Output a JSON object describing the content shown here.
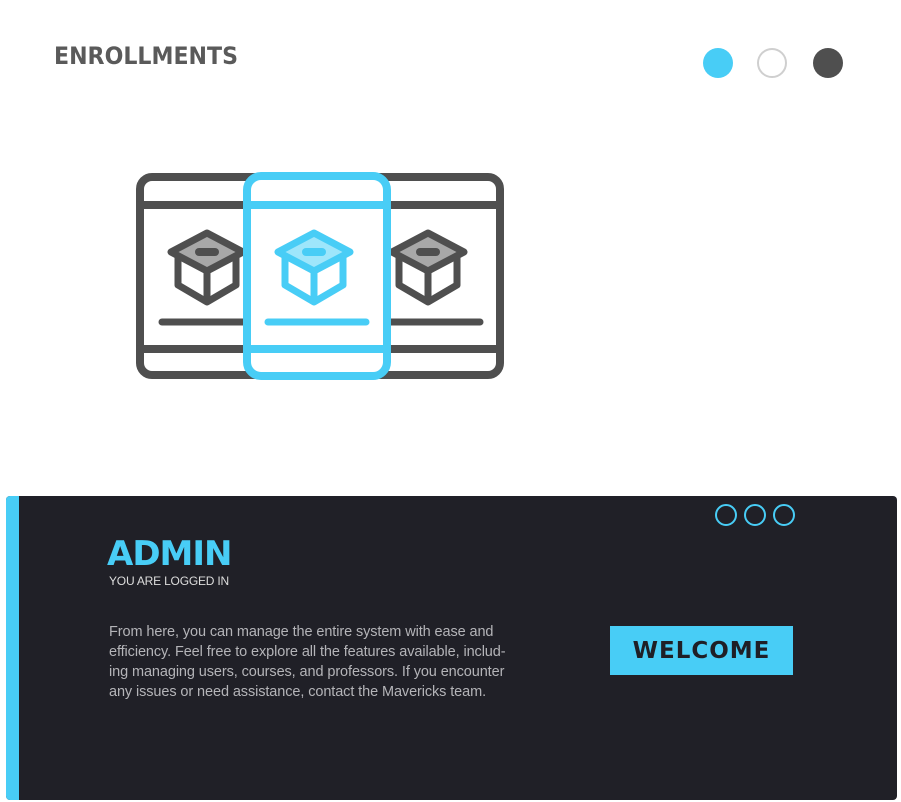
{
  "header": {
    "title": "ENROLLMENTS",
    "nav_dots": [
      {
        "state": "active",
        "color": "#48cdf6"
      },
      {
        "state": "empty",
        "color": "#ffffff"
      },
      {
        "state": "dark",
        "color": "#4f4f4f"
      }
    ]
  },
  "illustration": {
    "icon": "course-cards-illustration",
    "card_icon": "graduation-cap-icon",
    "colors": {
      "outline": "#4f4f4f",
      "highlight": "#48cdf6",
      "fill": "#a8a8a8",
      "highlight_fill": "#9ee6fb"
    }
  },
  "admin_panel": {
    "title": "ADMIN",
    "subtitle": "YOU ARE LOGGED IN",
    "description_lines": [
      "From here, you can manage the entire system with ease and",
      "efficiency. Feel free to explore all the features available, includ-",
      "ing managing users, courses, and professors. If you encounter",
      "any issues or need assistance, contact the Mavericks team."
    ],
    "button_label": "WELCOME",
    "menu_icon": "three-rings-icon",
    "colors": {
      "background": "#202027",
      "accent": "#48cdf6",
      "text": "#b4b4b8"
    }
  }
}
